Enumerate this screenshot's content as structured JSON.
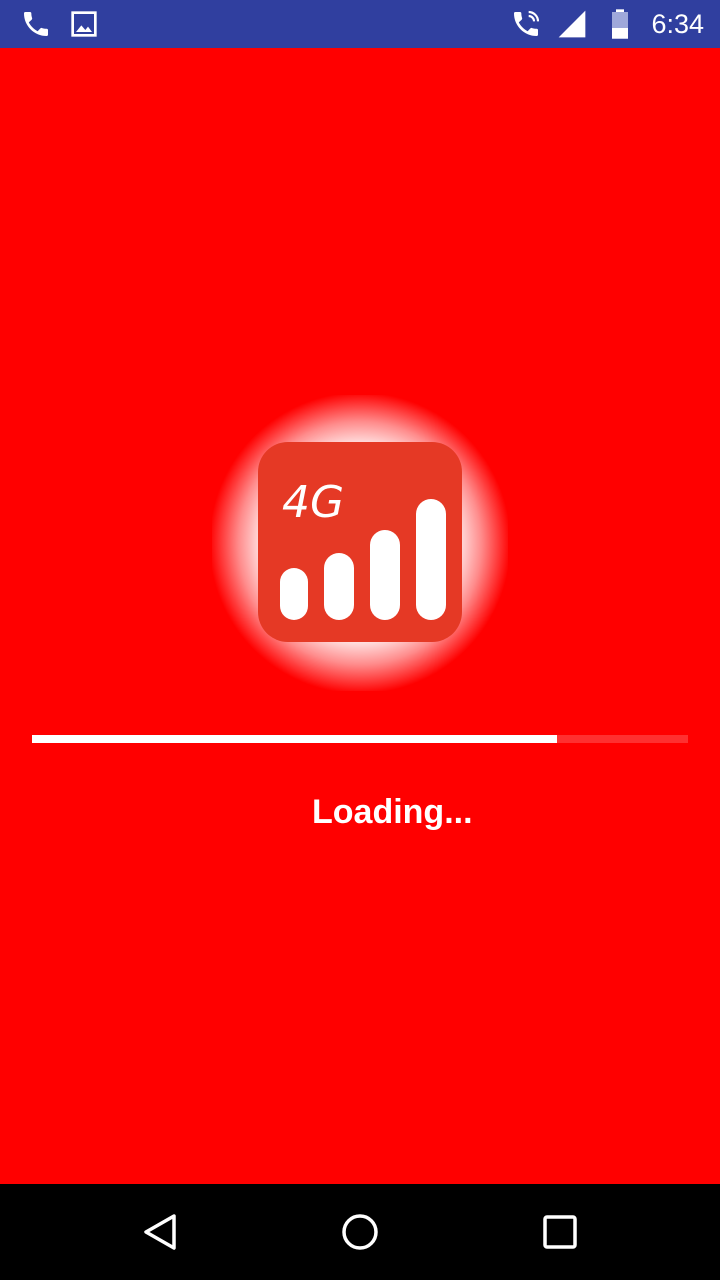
{
  "status_bar": {
    "time": "6:34",
    "icons": [
      "phone-icon",
      "image-icon",
      "wifi-calling-icon",
      "signal-icon",
      "battery-icon"
    ],
    "background_color": "#303f9f"
  },
  "splash": {
    "background_color": "#ff0000",
    "logo": {
      "text": "4G",
      "icon": "signal-bars-icon",
      "tile_color": "#e53925"
    },
    "progress": {
      "fraction": 0.8
    },
    "loading_text": "Loading..."
  },
  "nav_bar": {
    "buttons": [
      "back-icon",
      "home-icon",
      "recents-icon"
    ]
  }
}
